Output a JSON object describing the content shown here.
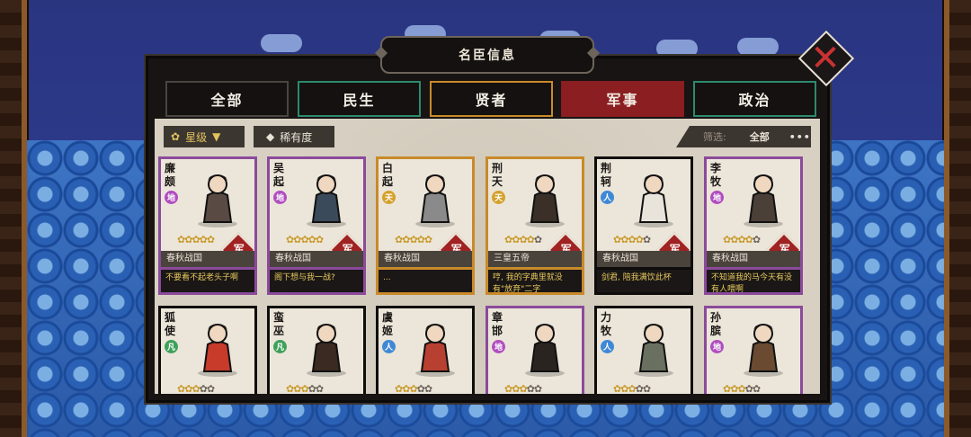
{
  "title": "名臣信息",
  "tabs": [
    {
      "label": "全部",
      "border": "#4a4540",
      "active": false
    },
    {
      "label": "民生",
      "border": "#2d8a6e",
      "active": false
    },
    {
      "label": "贤者",
      "border": "#c98a2a",
      "active": false
    },
    {
      "label": "军事",
      "border": "#8a1e20",
      "active": true
    },
    {
      "label": "政治",
      "border": "#2d8a6e",
      "active": false
    }
  ],
  "filters": {
    "star_label": "星级",
    "rarity_label": "稀有度",
    "screen_label": "筛选:",
    "screen_value": "全部",
    "more": "•••"
  },
  "rank_colors": {
    "地": "#b04ec0",
    "天": "#d4a12a",
    "人": "#3f88d6",
    "凡": "#3fa05a"
  },
  "cards": [
    {
      "name": "廉颇",
      "rank": "地",
      "frame": "purple",
      "stars_on": 5,
      "stars_total": 5,
      "era": "春秋战国",
      "quote": "不要看不起老头子啊",
      "army": "军"
    },
    {
      "name": "吴起",
      "rank": "地",
      "frame": "purple",
      "stars_on": 5,
      "stars_total": 5,
      "era": "春秋战国",
      "quote": "阁下想与我一战?",
      "army": "军"
    },
    {
      "name": "白起",
      "rank": "天",
      "frame": "gold",
      "stars_on": 5,
      "stars_total": 5,
      "era": "春秋战国",
      "quote": "...",
      "army": "军"
    },
    {
      "name": "刑天",
      "rank": "天",
      "frame": "gold",
      "stars_on": 4,
      "stars_total": 5,
      "era": "三皇五帝",
      "quote": "哼, 我的字典里就没有\"放弃\"二字",
      "army": "军"
    },
    {
      "name": "荆轲",
      "rank": "人",
      "frame": "black",
      "stars_on": 4,
      "stars_total": 5,
      "era": "春秋战国",
      "quote": "剑君, 陪我满饮此杯",
      "army": "军"
    },
    {
      "name": "李牧",
      "rank": "地",
      "frame": "purple",
      "stars_on": 4,
      "stars_total": 5,
      "era": "春秋战国",
      "quote": "不知道我的马今天有没有人喂啊",
      "army": "军"
    },
    {
      "name": "狐使",
      "rank": "凡",
      "frame": "black",
      "stars_on": 3,
      "stars_total": 5,
      "era": "",
      "quote": "",
      "army": ""
    },
    {
      "name": "蛮巫",
      "rank": "凡",
      "frame": "black",
      "stars_on": 3,
      "stars_total": 5,
      "era": "",
      "quote": "",
      "army": ""
    },
    {
      "name": "虞姬",
      "rank": "人",
      "frame": "black",
      "stars_on": 3,
      "stars_total": 5,
      "era": "",
      "quote": "",
      "army": ""
    },
    {
      "name": "章邯",
      "rank": "地",
      "frame": "purple",
      "stars_on": 3,
      "stars_total": 5,
      "era": "",
      "quote": "",
      "army": ""
    },
    {
      "name": "力牧",
      "rank": "人",
      "frame": "black",
      "stars_on": 3,
      "stars_total": 5,
      "era": "",
      "quote": "",
      "army": ""
    },
    {
      "name": "孙膑",
      "rank": "地",
      "frame": "purple",
      "stars_on": 3,
      "stars_total": 5,
      "era": "",
      "quote": "",
      "army": ""
    }
  ]
}
